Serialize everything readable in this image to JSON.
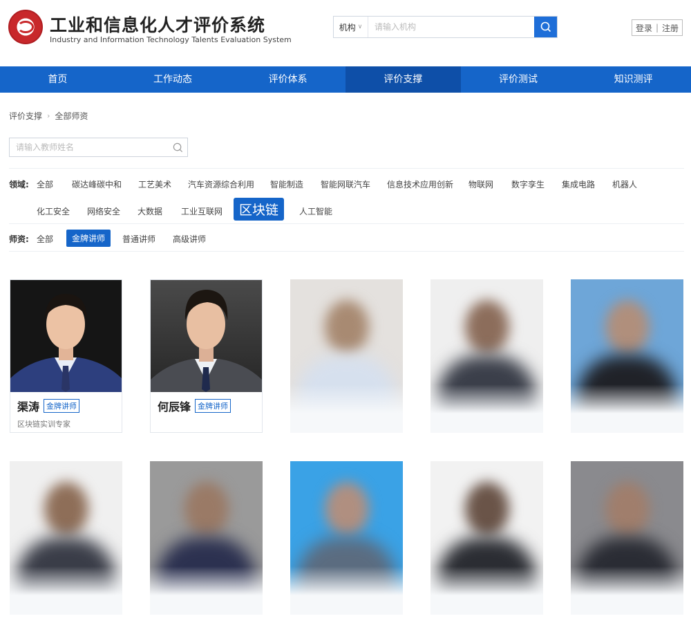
{
  "header": {
    "title_cn": "工业和信息化人才评价系统",
    "title_en": "Industry and Information Technology Talents Evaluation System",
    "search_select": "机构",
    "search_placeholder": "请输入机构",
    "login": "登录",
    "register": "注册",
    "auth_separator": "|"
  },
  "nav": [
    "首页",
    "工作动态",
    "评价体系",
    "评价支撑",
    "评价测试",
    "知识测评"
  ],
  "nav_active_index": 3,
  "breadcrumb": {
    "parent": "评价支撑",
    "current": "全部师资",
    "arrow": "›"
  },
  "teacher_search_placeholder": "请输入教师姓名",
  "filters": {
    "field_label": "领域:",
    "fields": [
      "全部",
      "碳达峰碳中和",
      "工艺美术",
      "汽车资源综合利用",
      "智能制造",
      "智能网联汽车",
      "信息技术应用创新",
      "物联网",
      "数字孪生",
      "集成电路",
      "机器人",
      "化工安全",
      "网络安全",
      "大数据",
      "工业互联网",
      "区块链",
      "人工智能"
    ],
    "field_active": "区块链",
    "level_label": "师资:",
    "levels": [
      "全部",
      "金牌讲师",
      "普通讲师",
      "高级讲师"
    ],
    "level_active": "金牌讲师"
  },
  "teachers": [
    {
      "name": "渠涛",
      "badge": "金牌讲师",
      "desc": "区块链实训专家"
    },
    {
      "name": "何辰锋",
      "badge": "金牌讲师",
      "desc": ""
    }
  ],
  "colors": {
    "primary": "#1565c9",
    "nav_active": "#0e4fa8"
  }
}
